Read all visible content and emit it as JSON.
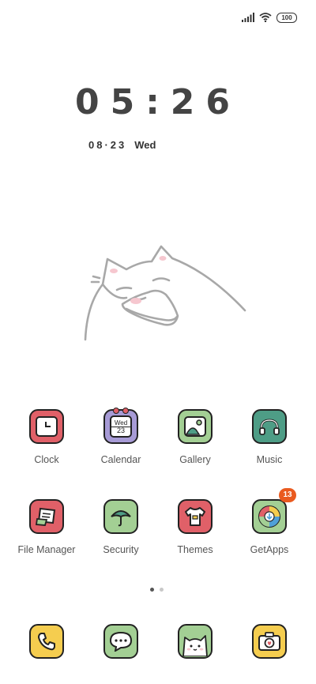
{
  "status": {
    "battery": "100",
    "icons": [
      "signal-icon",
      "wifi-icon"
    ]
  },
  "lockclock": {
    "time": "05:26",
    "date": "08·23",
    "weekday": "Wed"
  },
  "calendar_icon": {
    "weekday": "Wed",
    "day": "23"
  },
  "apps_row1": [
    {
      "label": "Clock",
      "color": "#e06068"
    },
    {
      "label": "Calendar",
      "color": "#a79bd6"
    },
    {
      "label": "Gallery",
      "color": "#a3cf94"
    },
    {
      "label": "Music",
      "color": "#4e9d86"
    }
  ],
  "apps_row2": [
    {
      "label": "File Manager",
      "color": "#e06068"
    },
    {
      "label": "Security",
      "color": "#a3cf94"
    },
    {
      "label": "Themes",
      "color": "#e06068"
    },
    {
      "label": "GetApps",
      "color": "#a3cf94",
      "badge": "13"
    }
  ],
  "dock": [
    {
      "name": "phone",
      "color": "#f5cd4f"
    },
    {
      "name": "messages",
      "color": "#a3cf94"
    },
    {
      "name": "cat-camera",
      "color": "#a3cf94"
    },
    {
      "name": "camera",
      "color": "#f5cd4f"
    }
  ],
  "pages": {
    "count": 2,
    "active": 1
  }
}
